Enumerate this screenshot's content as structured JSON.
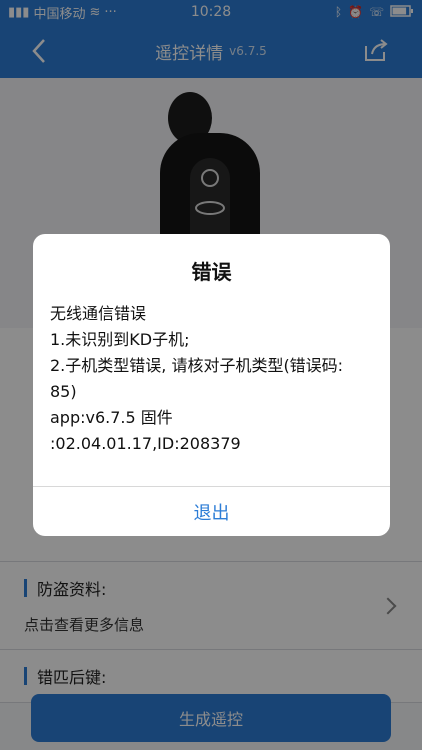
{
  "status_bar": {
    "carrier": "中国移动",
    "time": "10:28",
    "battery_level": 0.85
  },
  "nav": {
    "title": "遥控详情",
    "version": "v6.7.5"
  },
  "sections": [
    {
      "title": "防盗资料:",
      "subtitle": "点击查看更多信息"
    },
    {
      "title": "错匹后键:"
    }
  ],
  "bottom_button": {
    "label": "生成遥控"
  },
  "dialog": {
    "title": "错误",
    "lines": [
      "无线通信错误",
      "1.未识别到KD子机;",
      "2.子机类型错误, 请核对子机类型(错误码: 85)",
      "app:v6.7.5 固件",
      ":02.04.01.17,ID:208379"
    ],
    "exit_label": "退出"
  }
}
